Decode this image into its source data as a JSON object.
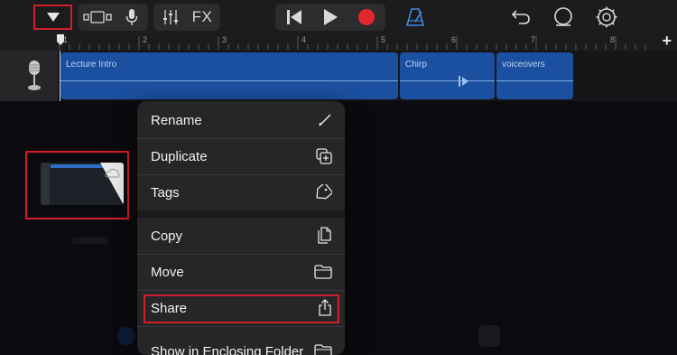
{
  "toolbar": {
    "fx_label": "FX",
    "record_color": "#e3282d",
    "metronome_color": "#3f8ae0",
    "highlight_color": "#d01f2a"
  },
  "ruler": {
    "marks": [
      "1",
      "2",
      "3",
      "4",
      "5",
      "6",
      "7",
      "8"
    ],
    "add_label": "+"
  },
  "track": {
    "regions": [
      {
        "label": "Lecture Intro"
      },
      {
        "label": "Chirp"
      },
      {
        "label": "voiceovers"
      }
    ],
    "region_color": "#1b4fa0"
  },
  "menu": {
    "items": [
      {
        "label": "Rename",
        "icon": "pencil-icon"
      },
      {
        "label": "Duplicate",
        "icon": "duplicate-icon"
      },
      {
        "label": "Tags",
        "icon": "tag-icon"
      },
      {
        "label": "Copy",
        "icon": "copy-icon"
      },
      {
        "label": "Move",
        "icon": "folder-icon"
      },
      {
        "label": "Share",
        "icon": "share-icon"
      },
      {
        "label": "Show in Enclosing Folder",
        "icon": "folder-icon"
      }
    ]
  }
}
